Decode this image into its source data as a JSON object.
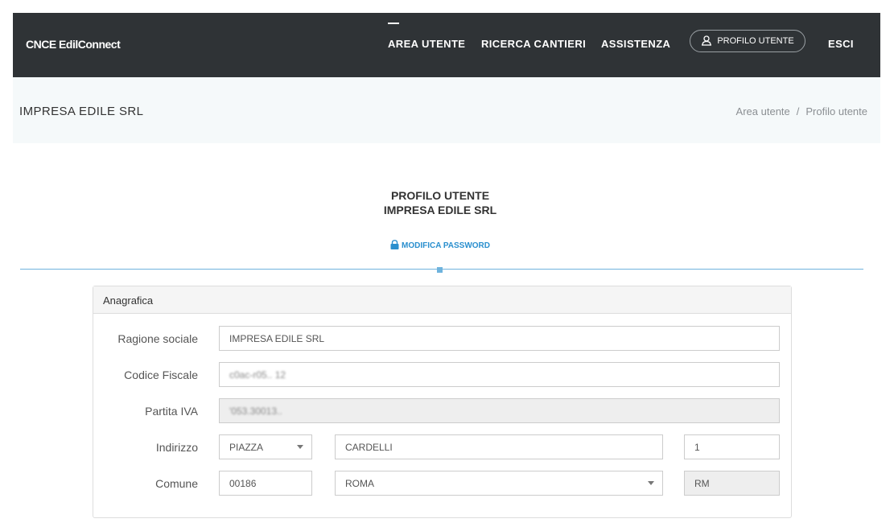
{
  "nav": {
    "brand": "CNCE EdilConnect",
    "items": [
      "AREA UTENTE",
      "RICERCA CANTIERI",
      "ASSISTENZA"
    ],
    "profile_label": "PROFILO UTENTE",
    "logout_label": "ESCI"
  },
  "subheader": {
    "company": "IMPRESA EDILE SRL",
    "breadcrumb": [
      "Area utente",
      "Profilo utente"
    ],
    "separator": "/"
  },
  "profile": {
    "title": "PROFILO UTENTE",
    "subtitle": "IMPRESA EDILE SRL",
    "password_link": "MODIFICA PASSWORD"
  },
  "panel": {
    "title": "Anagrafica",
    "labels": {
      "ragione_sociale": "Ragione sociale",
      "codice_fiscale": "Codice Fiscale",
      "partita_iva": "Partita IVA",
      "indirizzo": "Indirizzo",
      "comune": "Comune"
    },
    "values": {
      "ragione_sociale": "IMPRESA EDILE SRL",
      "codice_fiscale": "c0ac-r05.. 12",
      "partita_iva": "'053.30013..",
      "indirizzo_tipo": "PIAZZA",
      "indirizzo_via": "CARDELLI",
      "indirizzo_civico": "1",
      "cap": "00186",
      "comune": "ROMA",
      "provincia": "RM"
    }
  },
  "colors": {
    "navbar": "#2f3336",
    "accent": "#2a8fce",
    "subheader_bg": "#f5f9fa"
  }
}
